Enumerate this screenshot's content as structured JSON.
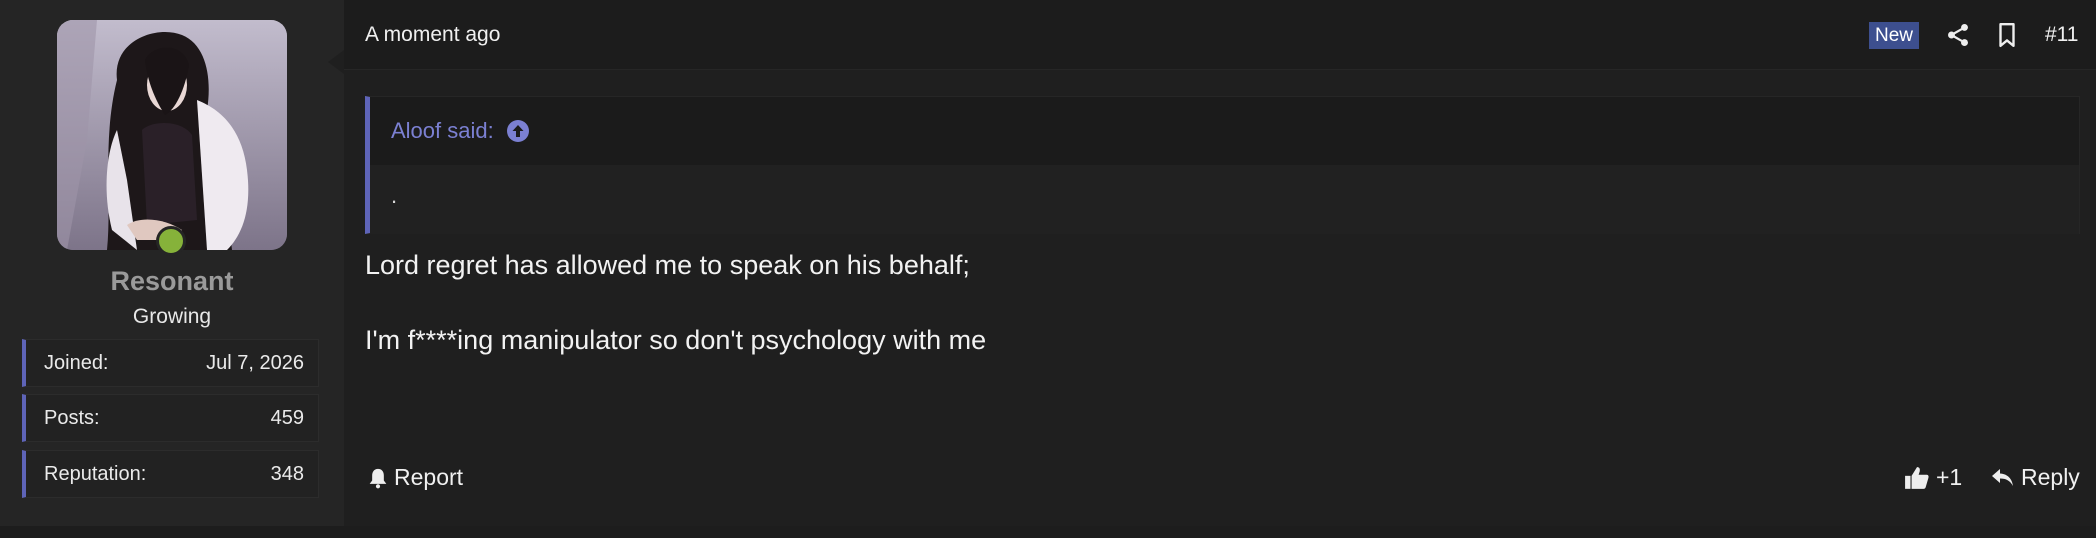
{
  "user": {
    "name": "Resonant",
    "title": "Growing",
    "status_color": "#86b23a",
    "stats": [
      {
        "label": "Joined:",
        "value": "Jul 7, 2026"
      },
      {
        "label": "Posts:",
        "value": "459"
      },
      {
        "label": "Reputation:",
        "value": "348"
      }
    ]
  },
  "post": {
    "time": "A moment ago",
    "badge": "New",
    "number": "#11",
    "icons": [
      "share-icon",
      "bookmark-icon"
    ]
  },
  "quote": {
    "author": "Aloof said:",
    "body": "."
  },
  "message": {
    "lines": [
      "Lord regret has allowed me to speak on his behalf;",
      "I'm f****ing manipulator so don't psychology with me"
    ]
  },
  "actions": {
    "report": "Report",
    "react": "+1",
    "reply": "Reply"
  },
  "colors": {
    "accent": "#5e64b8",
    "quote_author": "#7b80d2",
    "badge_bg": "#3d4f8f"
  }
}
